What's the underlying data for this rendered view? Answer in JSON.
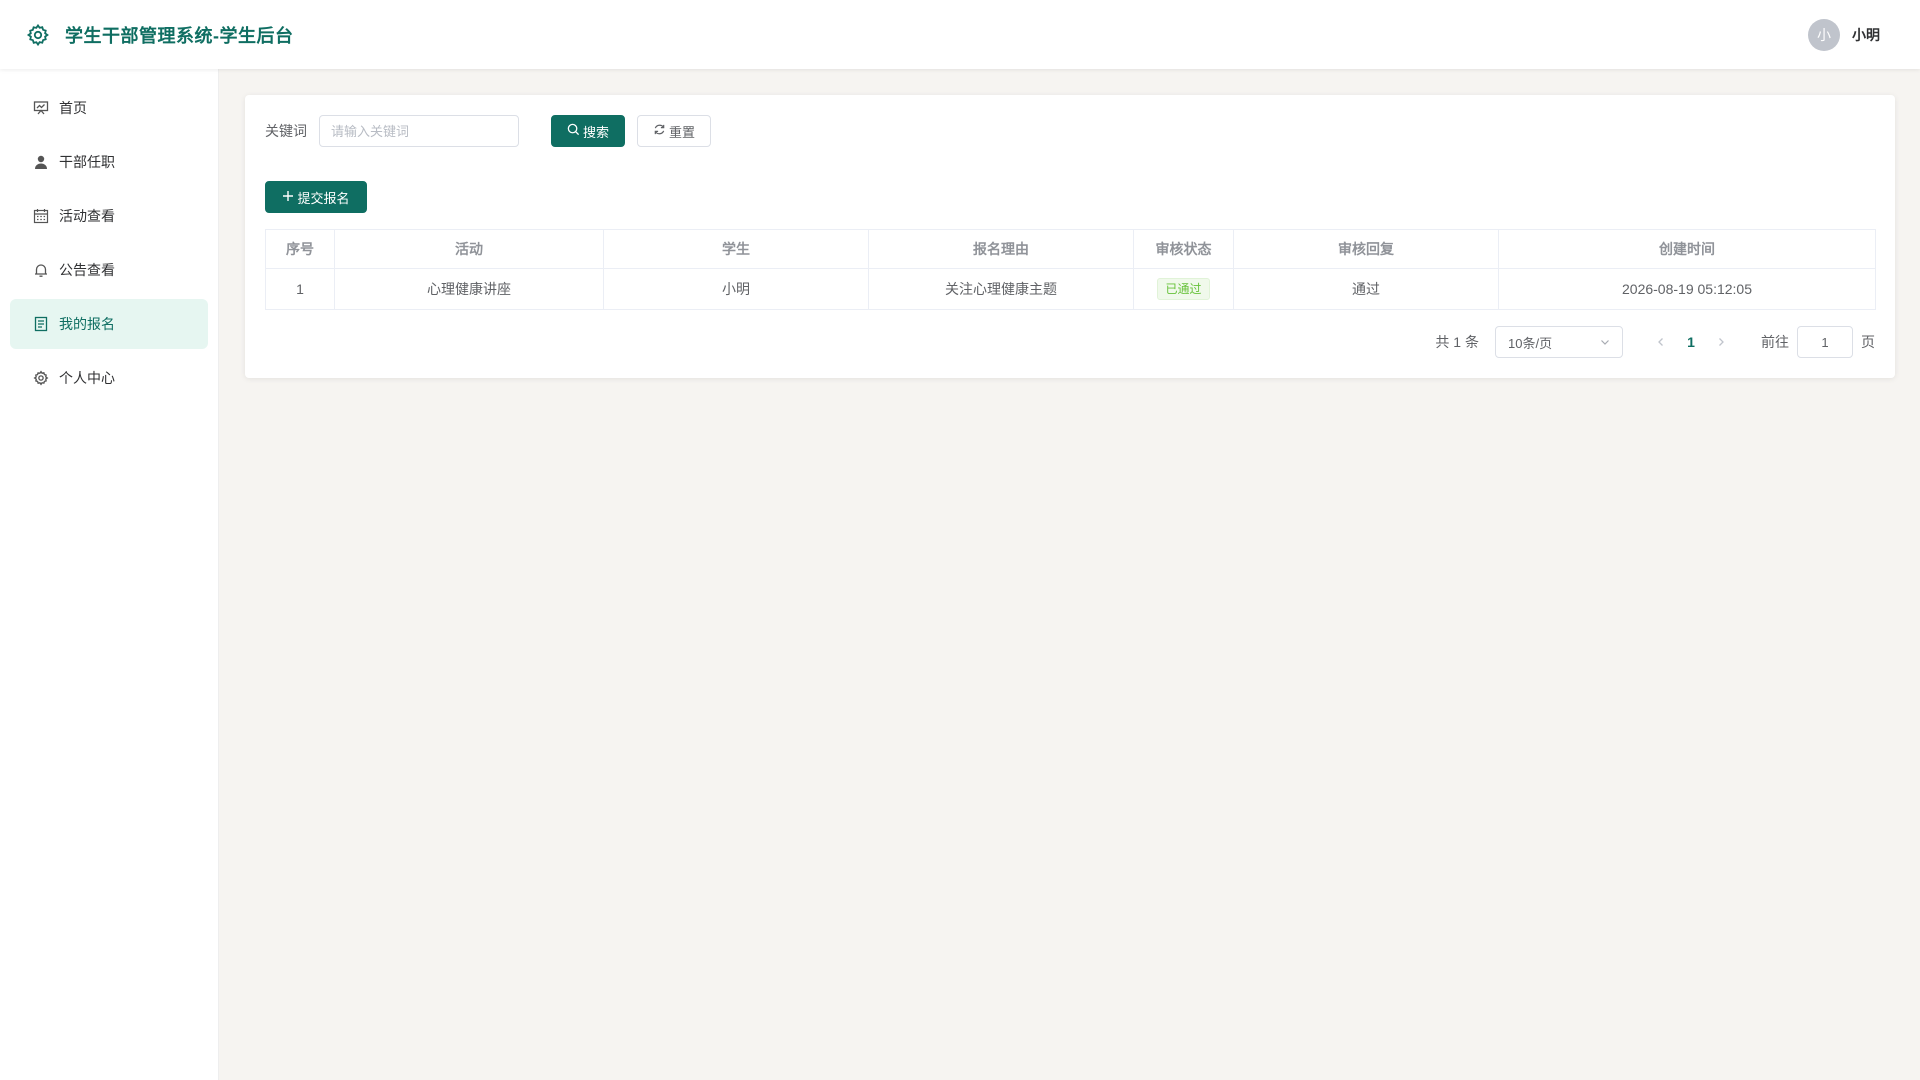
{
  "header": {
    "title": "学生干部管理系统-学生后台",
    "user": {
      "avatar_text": "小",
      "name": "小明"
    }
  },
  "sidebar": {
    "items": [
      {
        "label": "首页",
        "icon": "presentation-icon"
      },
      {
        "label": "干部任职",
        "icon": "user-icon"
      },
      {
        "label": "活动查看",
        "icon": "calendar-icon"
      },
      {
        "label": "公告查看",
        "icon": "bell-icon"
      },
      {
        "label": "我的报名",
        "icon": "document-icon",
        "active": true
      },
      {
        "label": "个人中心",
        "icon": "gear-icon"
      }
    ]
  },
  "search": {
    "label": "关键词",
    "placeholder": "请输入关键词",
    "search_button": "搜索",
    "reset_button": "重置"
  },
  "actions": {
    "add_button": "提交报名"
  },
  "table": {
    "columns": [
      "序号",
      "活动",
      "学生",
      "报名理由",
      "审核状态",
      "审核回复",
      "创建时间"
    ],
    "rows": [
      {
        "index": "1",
        "activity": "心理健康讲座",
        "student": "小明",
        "reason": "关注心理健康主题",
        "status": "已通过",
        "reply": "通过",
        "created": "2026-08-19 05:12:05"
      }
    ]
  },
  "pagination": {
    "total_text": "共 1 条",
    "page_size": "10条/页",
    "current_page": "1",
    "goto_label": "前往",
    "goto_value": "1",
    "page_suffix": "页"
  },
  "colors": {
    "primary": "#0f6e62",
    "active_bg": "#e6f6f1",
    "success": "#67c23a",
    "page_bg": "#f6f4f1"
  }
}
